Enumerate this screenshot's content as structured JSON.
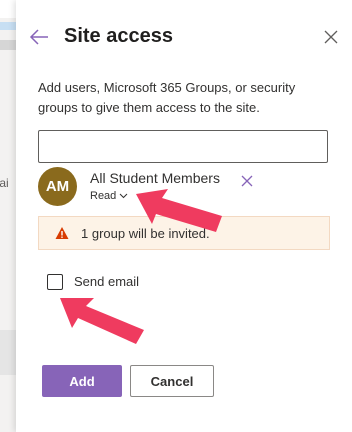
{
  "background": {
    "partial_text": "tai"
  },
  "panel": {
    "title": "Site access",
    "description": "Add users, Microsoft 365 Groups, or security groups to give them access to the site.",
    "input": {
      "value": "",
      "placeholder": ""
    },
    "member": {
      "initials": "AM",
      "name": "All Student Members",
      "permission": "Read",
      "avatar_color": "#8a6a1d"
    },
    "warning": {
      "text": "1 group will be invited.",
      "icon": "warning-icon"
    },
    "send_email": {
      "label": "Send email",
      "checked": false
    },
    "buttons": {
      "add": "Add",
      "cancel": "Cancel"
    }
  },
  "colors": {
    "accent": "#8764b8",
    "annotation_arrow": "#ef3b5f",
    "warning_bg": "#fdf3e7",
    "warning_icon": "#d83b01"
  }
}
